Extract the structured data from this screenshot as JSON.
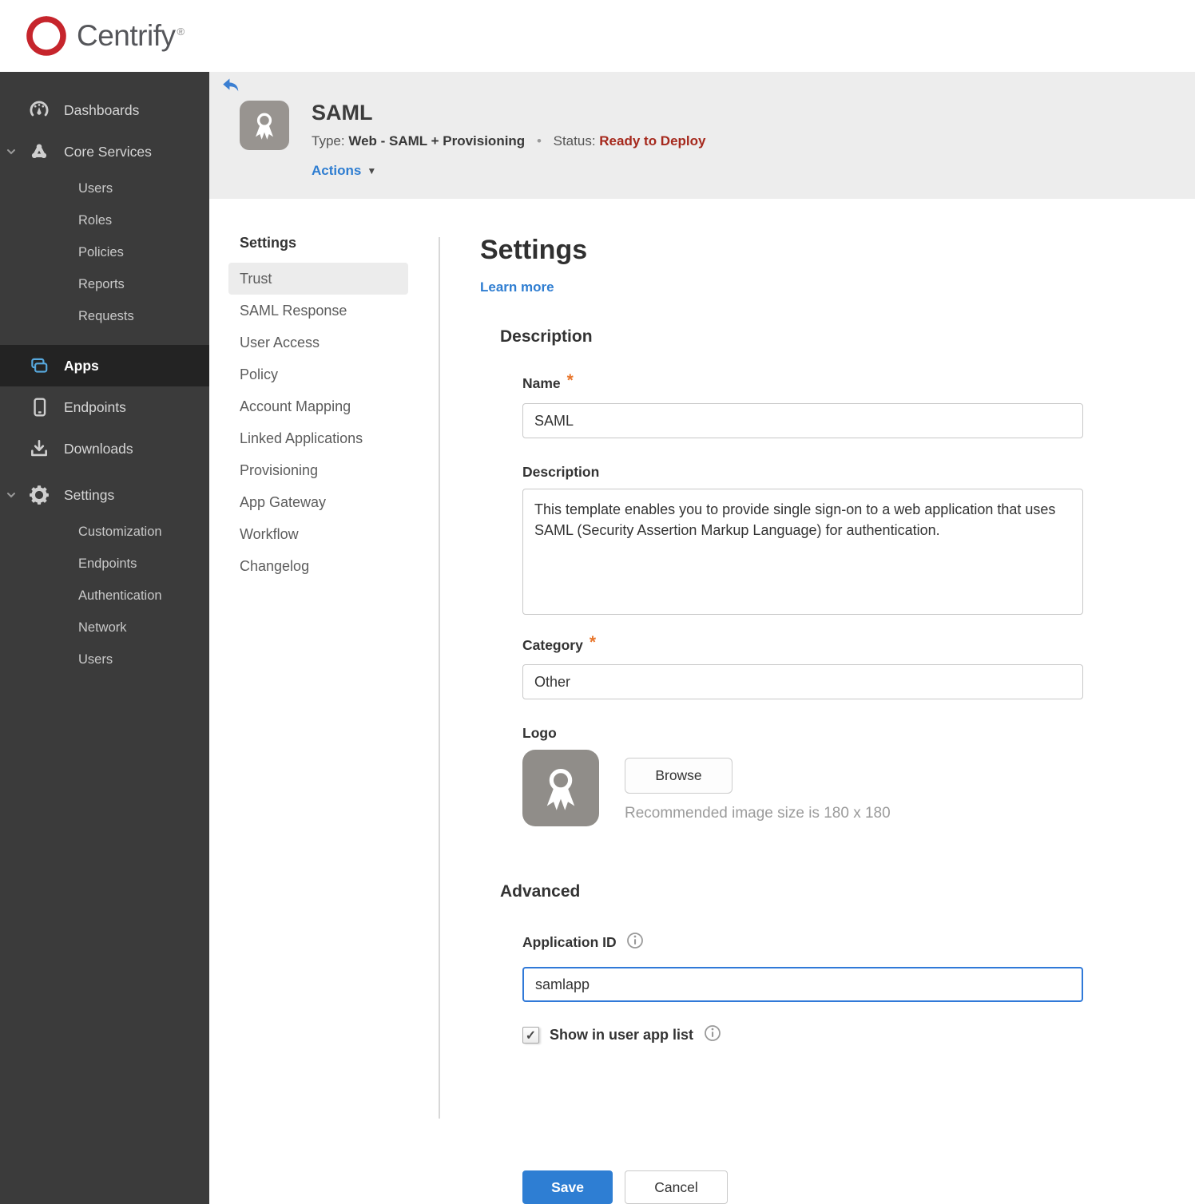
{
  "brand": {
    "name": "Centrify",
    "registered_mark": "®"
  },
  "colors": {
    "accent_blue": "#2e7ed3",
    "status_red": "#a5281c",
    "asterisk_orange": "#e8762c",
    "sidebar_bg": "#3b3b3b",
    "sidebar_active_bg": "#232323",
    "apps_icon_blue": "#57a8dd",
    "brand_red": "#c6252c",
    "header_band_gray": "#ededed"
  },
  "sidebar": {
    "items": [
      {
        "label": "Dashboards",
        "icon": "gauge-icon"
      },
      {
        "label": "Core Services",
        "icon": "cluster-icon",
        "expanded": true
      },
      {
        "label": "Users"
      },
      {
        "label": "Roles"
      },
      {
        "label": "Policies"
      },
      {
        "label": "Reports"
      },
      {
        "label": "Requests"
      },
      {
        "label": "Apps",
        "icon": "apps-icon",
        "active": true
      },
      {
        "label": "Endpoints",
        "icon": "phone-icon"
      },
      {
        "label": "Downloads",
        "icon": "download-icon"
      },
      {
        "label": "Settings",
        "icon": "gear-icon",
        "expanded": true
      },
      {
        "label": "Customization"
      },
      {
        "label": "Endpoints"
      },
      {
        "label": "Authentication"
      },
      {
        "label": "Network"
      },
      {
        "label": "Users"
      }
    ]
  },
  "app_header": {
    "title": "SAML",
    "type_label": "Type:",
    "type_value": "Web - SAML + Provisioning",
    "separator": "•",
    "status_label": "Status:",
    "status_value": "Ready to Deploy",
    "actions_label": "Actions",
    "actions_caret": "▼"
  },
  "subnav": {
    "header": "Settings",
    "items": [
      {
        "label": "Trust",
        "active": true
      },
      {
        "label": "SAML Response"
      },
      {
        "label": "User Access"
      },
      {
        "label": "Policy"
      },
      {
        "label": "Account Mapping"
      },
      {
        "label": "Linked Applications"
      },
      {
        "label": "Provisioning"
      },
      {
        "label": "App Gateway"
      },
      {
        "label": "Workflow"
      },
      {
        "label": "Changelog"
      }
    ]
  },
  "main": {
    "title": "Settings",
    "learn_more": "Learn more",
    "required_mark": "*",
    "description_section": {
      "heading": "Description",
      "name_label": "Name",
      "name_value": "SAML",
      "description_label": "Description",
      "description_value": "This template enables you to provide single sign-on to a web application that uses SAML (Security Assertion Markup Language) for authentication.",
      "category_label": "Category",
      "category_value": "Other",
      "logo_label": "Logo",
      "browse_label": "Browse",
      "logo_hint": "Recommended image size is 180 x 180"
    },
    "advanced_section": {
      "heading": "Advanced",
      "application_id_label": "Application ID",
      "application_id_value": "samlapp",
      "show_label": "Show in user app list",
      "checkbox_glyph": "✓",
      "checked": true
    },
    "footer": {
      "save_label": "Save",
      "cancel_label": "Cancel"
    }
  }
}
